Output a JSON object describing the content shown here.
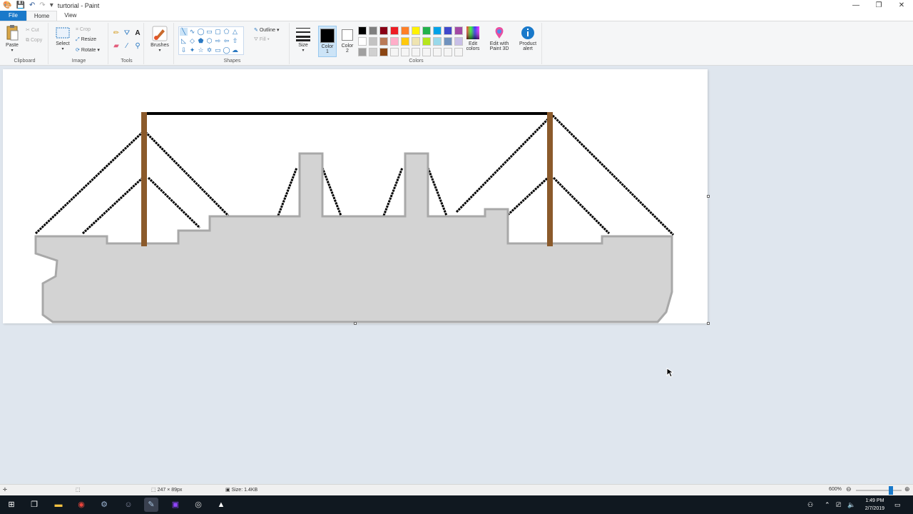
{
  "window": {
    "title": "turtorial - Paint",
    "controls": [
      "—",
      "❐",
      "✕"
    ]
  },
  "tabs": {
    "file": "File",
    "home": "Home",
    "view": "View"
  },
  "ribbon": {
    "clipboard": {
      "paste": "Paste",
      "cut": "Cut",
      "copy": "Copy",
      "label": "Clipboard"
    },
    "image": {
      "select": "Select",
      "crop": "Crop",
      "resize": "Resize",
      "rotate": "Rotate",
      "label": "Image"
    },
    "tools": {
      "label": "Tools"
    },
    "brushes": {
      "label": "Brushes"
    },
    "shapes": {
      "outline": "Outline",
      "fill": "Fill",
      "label": "Shapes"
    },
    "size": {
      "label": "Size"
    },
    "colors": {
      "color1_label": "Color",
      "color1_num": "1",
      "color2_label": "Color",
      "color2_num": "2",
      "color1": "#000000",
      "color2": "#ffffff",
      "edit_colors_1": "Edit",
      "edit_colors_2": "colors",
      "edit_paint3d_1": "Edit with",
      "edit_paint3d_2": "Paint 3D",
      "product_alert_1": "Product",
      "product_alert_2": "alert",
      "label": "Colors",
      "palette": [
        "#000000",
        "#7f7f7f",
        "#880015",
        "#ed1c24",
        "#ff7f27",
        "#fff200",
        "#22b14c",
        "#00a2e8",
        "#3f48cc",
        "#a349a4",
        "#ffffff",
        "#c3c3c3",
        "#b97a57",
        "#ffaec9",
        "#ffc90e",
        "#efe4b0",
        "#b5e61d",
        "#99d9ea",
        "#7092be",
        "#c8bfe7",
        "#a0a0a0",
        "#d0d0d0",
        "#8b4513",
        "#f5f5f5",
        "#f5f5f5",
        "#f5f5f5",
        "#f5f5f5",
        "#f5f5f5",
        "#f5f5f5",
        "#f5f5f5"
      ]
    }
  },
  "drawing": {
    "hull_color": "#d3d3d3",
    "hull_outline": "#a8a8a8",
    "mast_color": "#8b5a2b",
    "rope_color": "#000000"
  },
  "status": {
    "dimensions": "247 × 89px",
    "size": "Size: 1.4KB",
    "zoom": "600%",
    "zoom_level": 0.8
  },
  "taskbar": {
    "time": "1:49 PM",
    "date": "2/7/2019"
  }
}
